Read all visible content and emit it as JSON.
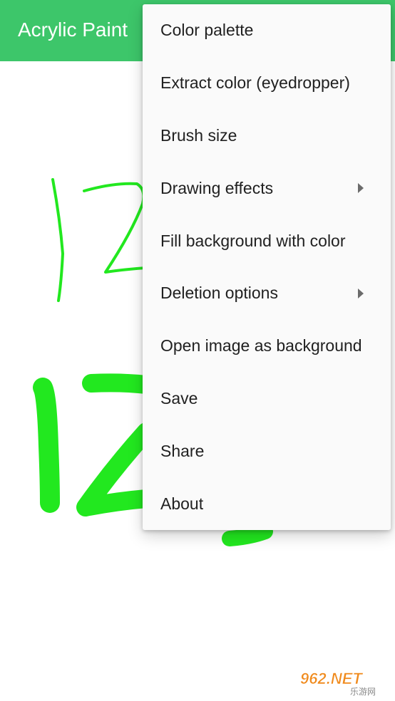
{
  "app": {
    "title": "Acrylic Paint",
    "accent_color": "#3dc66a",
    "stroke_color": "#22e81f"
  },
  "menu": {
    "items": [
      {
        "label": "Color palette",
        "submenu": false
      },
      {
        "label": "Extract color (eyedropper)",
        "submenu": false
      },
      {
        "label": "Brush size",
        "submenu": false
      },
      {
        "label": "Drawing effects",
        "submenu": true
      },
      {
        "label": "Fill background with color",
        "submenu": false
      },
      {
        "label": "Deletion options",
        "submenu": true
      },
      {
        "label": "Open image as background",
        "submenu": false
      },
      {
        "label": "Save",
        "submenu": false
      },
      {
        "label": "Share",
        "submenu": false
      },
      {
        "label": "About",
        "submenu": false
      }
    ]
  },
  "watermark": {
    "text": "962.NET",
    "subtext": "乐游网"
  }
}
